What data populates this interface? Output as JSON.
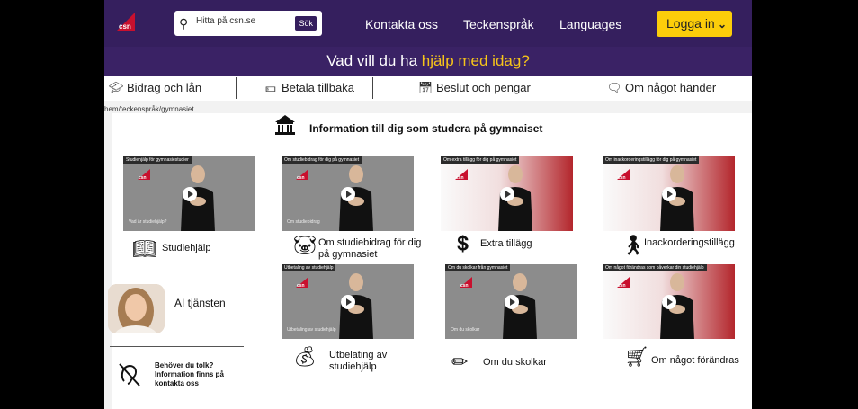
{
  "header": {
    "logo_text": "csn",
    "search": {
      "placeholder": "Hitta på csn.se",
      "button": "Sök"
    },
    "nav": [
      "Kontakta oss",
      "Teckenspråk",
      "Languages"
    ],
    "login": "Logga in"
  },
  "help": {
    "prefix": "Vad vill du ha ",
    "highlight": "hjälp med idag?"
  },
  "categories": [
    {
      "label": "Bidrag och lån",
      "icon": "graduation-cap-icon"
    },
    {
      "label": "Betala tillbaka",
      "icon": "money-icon"
    },
    {
      "label": "Beslut och pengar",
      "icon": "calendar-icon"
    },
    {
      "label": "Om något händer",
      "icon": "chat-icon"
    }
  ],
  "breadcrumb": "hem/teckenspråk/gymnasiet",
  "heading": "Information till dig som studera på gymnaiset",
  "videos": [
    {
      "title": "Studiehjälp för gymnasiestudier",
      "caption": "Vad är studiehjälp?",
      "label": "Studiehjälp",
      "icon": "book-hand-icon"
    },
    {
      "title": "Om studiebidrag för dig på gymnasiet",
      "caption": "Om studiebidrag",
      "label": "Om studiebidrag för dig på gymnasiet",
      "icon": "piggy-bank-icon"
    },
    {
      "title": "Om extra tillägg för dig på gymnasiet",
      "caption": "",
      "label": "Extra tillägg",
      "icon": "coin-hand-icon"
    },
    {
      "title": "Om inackorderingstillägg för dig på gymnasiet",
      "caption": "",
      "label": "Inackorderingstillägg",
      "icon": "traveler-icon"
    },
    {
      "title": "Utbetaling av studiehjälp",
      "caption": "Utbetaling av studiehjälp",
      "label": "Utbelating av studiehjälp",
      "icon": "money-bag-icon"
    },
    {
      "title": "Om du skolkar från gymnasiet",
      "caption": "Om du skolkar",
      "label": "Om du skolkar",
      "icon": "pencil-icon"
    },
    {
      "title": "Om något förändras som påverkar din studiehjälp",
      "caption": "",
      "label": "Om något förändras",
      "icon": "hand-truck-icon"
    }
  ],
  "ai": {
    "label": "AI tjänsten"
  },
  "tolk": {
    "text": "Behöver du tolk? Information finns på kontakta oss"
  },
  "colors": {
    "brand": "#351f5e",
    "accent": "#fccd0a",
    "highlight": "#f6c41a",
    "logo_red": "#c8102e"
  }
}
